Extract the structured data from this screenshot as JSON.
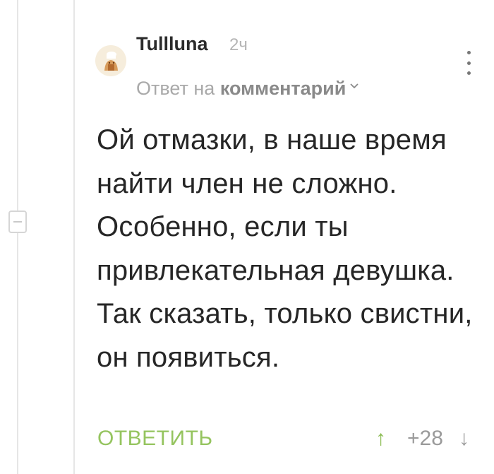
{
  "comment": {
    "username": "Tullluna",
    "time": "2ч",
    "reply_prefix": "Ответ на",
    "reply_link": "комментарий",
    "text": "Ой отмазки, в наше время найти член не сложно. Особенно, если ты привлекательная девушка. Так сказать, только свистни, он появиться.",
    "reply_button": "ОТВЕТИТЬ",
    "vote_up": "↑",
    "rating": "+28",
    "vote_down": "↓"
  },
  "icons": {
    "avatar": "avatar-image",
    "chevron": "chevron-down-icon",
    "more": "more-vertical-icon",
    "collapse": "collapse-minus-icon"
  },
  "colors": {
    "accent_green": "#95c45f",
    "text": "#262626",
    "muted": "#a9a9a9",
    "thread_line": "#e6e6e6"
  }
}
